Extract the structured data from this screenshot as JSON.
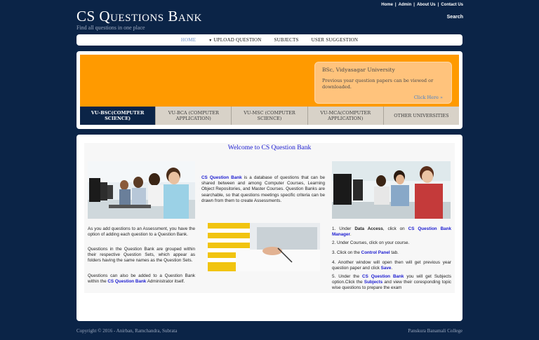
{
  "header": {
    "title": "CS Questions Bank",
    "subtitle": "Find all questions in one place",
    "top_links": [
      "Home",
      "Admin",
      "About Us",
      "Contact Us"
    ],
    "search_label": "Search"
  },
  "nav": {
    "items": [
      "HOME",
      "UPLOAD QUESTION",
      "SUBJECTS",
      "USER SUGGESTION"
    ]
  },
  "hero": {
    "card_title": "BSc, Vidyasagar University",
    "card_text": "Previous year question papers can be viewed or downloaded.",
    "card_link": "Click Here »",
    "tabs": [
      "VU-BSC(COMPUTER SCIENCE)",
      "VU-BCA (COMPUTER APPLICATION)",
      "VU-MSC (COMPUTER SCIENCE)",
      "VU-MCA(COMPUTER APPLICATION)",
      "OTHER UNIVERSITIES"
    ]
  },
  "content": {
    "welcome": "Welcome to CS Question Bank",
    "intro_link": "CS Question Bank",
    "intro_text": " is a database of questions that can be shared between and among Computer Courses, Learning Object Repositories, and Master Courses. Question Banks are searchable, so that questions meetings specific criteria can be drawn from them to create Assessments.",
    "left_p1": "As you add questions to an Assessment, you have the option of adding each question to a Question Bank.",
    "left_p2": "Questions in the Question Bank are grouped within their respective Question Sets, which appear as folders having the same names as the Question Sets.",
    "left_p3_a": "Questions can also be added to a Question Bank within the ",
    "left_p3_link": "CS Question Bank",
    "left_p3_b": " Administrator itself.",
    "steps": {
      "s1_a": "1.  Under ",
      "s1_bold": "Data Access",
      "s1_b": ", click on ",
      "s1_link": "CS Question Bank Manager",
      "s1_c": ".",
      "s2": "2.  Under Courses, click on your course.",
      "s3_a": "3.  Click on the ",
      "s3_link": "Control Panel",
      "s3_b": " tab.",
      "s4_a": "4.  Another window will open then will get previous year question paper and click ",
      "s4_link": "Save",
      "s4_b": ".",
      "s5_a": "5. Under the ",
      "s5_link1": "CS Question Bank",
      "s5_b": " you will get Subjects option.Click the ",
      "s5_link2": "Subjects",
      "s5_c": " and view their coresponding topic wise questions to prepare the exam"
    }
  },
  "footer": {
    "left": "Copyright © 2016 - Anirban, Ramchandra, Subrata",
    "right": "Panskura Banamali College"
  },
  "colors": {
    "background": "#0b2447",
    "accent_orange": "#ff9a00",
    "link_blue": "#1a1ad0"
  }
}
